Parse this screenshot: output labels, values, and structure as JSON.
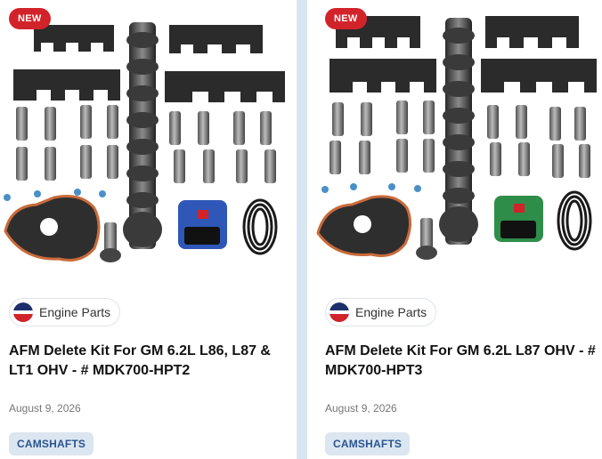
{
  "products": [
    {
      "badge": "NEW",
      "category": "Engine Parts",
      "title": "AFM Delete Kit For GM 6.2L L86, L87 & LT1 OHV - # MDK700-HPT2",
      "date": "August 9, 2026",
      "tag": "CAMSHAFTS",
      "tuner_color": "#2e57b8",
      "tuner_icon": "tuner-blue-icon"
    },
    {
      "badge": "NEW",
      "category": "Engine Parts",
      "title": "AFM Delete Kit For GM 6.2L L87 OHV - # MDK700-HPT3",
      "date": "August 9, 2026",
      "tag": "CAMSHAFTS",
      "tuner_color": "#2f8d4a",
      "tuner_icon": "tuner-green-icon"
    }
  ],
  "colors": {
    "badge_red": "#d2232a",
    "tag_bg": "#dbe6f1",
    "tag_text": "#2a5590",
    "page_bg": "#d9e6f2"
  }
}
